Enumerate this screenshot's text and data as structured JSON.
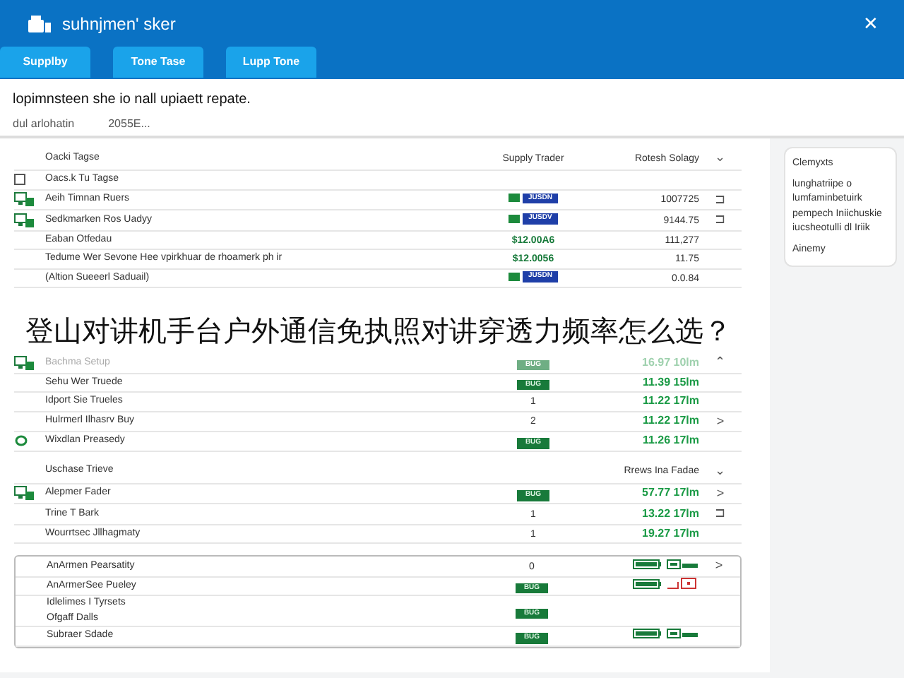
{
  "header": {
    "title": "suhnjmen' sker",
    "close": "✕"
  },
  "tabs": [
    {
      "label": "Supplby",
      "selected": false
    },
    {
      "label": "Tone Tase",
      "selected": false
    },
    {
      "label": "Lupp Tone",
      "selected": false
    }
  ],
  "info": {
    "line": "lopimnsteen she io nall upiaett repate.",
    "meta": [
      "dul arlohatin",
      "2055E..."
    ]
  },
  "sections": [
    {
      "title": "Oacki Tagse",
      "columns": [
        "Supply Trader",
        "Rotesh Solagy"
      ],
      "chevron": "⌄",
      "rows": [
        {
          "kind": "checkbox",
          "checked": false,
          "name": "Oacs.k Tu Tagse",
          "cells": []
        },
        {
          "kind": "monitor",
          "name": "Aeih Timnan Ruers",
          "cells": [
            {
              "kind": "badge",
              "text": "JUSDN"
            },
            {
              "kind": "text",
              "text": "1007725"
            }
          ],
          "action": "⊐"
        },
        {
          "kind": "monitor",
          "name": "Sedkmarken Ros Uadyy",
          "cells": [
            {
              "kind": "badge",
              "text": "JUSDV"
            },
            {
              "kind": "text",
              "text": "9144.75"
            }
          ],
          "action": "⊐"
        },
        {
          "kind": "plain",
          "name": "Eaban Otfedau",
          "cells": [
            {
              "kind": "money",
              "text": "$12.00A6"
            },
            {
              "kind": "text",
              "text": "111,277"
            }
          ]
        },
        {
          "kind": "plain",
          "name": "Tedume Wer Sevone Hee vpirkhuar de rhoamerk ph ir",
          "cells": [
            {
              "kind": "money",
              "text": "$12.0056"
            },
            {
              "kind": "text",
              "text": "11.75"
            }
          ]
        },
        {
          "kind": "plain",
          "name": "(Altion Sueeerl Saduail)",
          "cells": [
            {
              "kind": "badge",
              "text": "JUSDN"
            },
            {
              "kind": "text",
              "text": "0.0.84"
            }
          ]
        }
      ]
    },
    {
      "rows": [
        {
          "kind": "monitor",
          "disabled": true,
          "name": "Bachma Setup",
          "cells": [
            {
              "kind": "chip",
              "text": "BUG"
            },
            {
              "kind": "reading",
              "text": "16.97 10lm"
            }
          ],
          "action": "⌃"
        },
        {
          "kind": "plain",
          "disabled": false,
          "name": "Sehu Wer Truede",
          "cells": [
            {
              "kind": "chip",
              "text": "BUG"
            },
            {
              "kind": "reading",
              "text": "11.39 15lm"
            }
          ]
        },
        {
          "kind": "plain",
          "disabled": false,
          "name": "Idport Sie Trueles",
          "cells": [
            {
              "kind": "text",
              "text": "1"
            },
            {
              "kind": "reading",
              "text": "11.22 17lm"
            }
          ]
        },
        {
          "kind": "plain",
          "disabled": false,
          "name": "Hulrmerl Ilhasrv Buy",
          "cells": [
            {
              "kind": "text",
              "text": "2"
            },
            {
              "kind": "reading",
              "text": "11.22 17lm"
            }
          ],
          "action": ">"
        },
        {
          "kind": "ring",
          "disabled": false,
          "name": "Wixdlan Preasedy",
          "cells": [
            {
              "kind": "chip",
              "text": "BUG"
            },
            {
              "kind": "reading",
              "text": "11.26 17lm"
            }
          ]
        }
      ]
    },
    {
      "title": "Uschase Trieve",
      "columns": [
        "",
        "Rrews Ina Fadae"
      ],
      "chevron": "⌄",
      "rows": [
        {
          "kind": "monitor",
          "name": "Alepmer Fader",
          "cells": [
            {
              "kind": "chip",
              "text": "BUG"
            },
            {
              "kind": "reading",
              "text": "57.77 17lm"
            }
          ],
          "action": ">"
        },
        {
          "kind": "plain",
          "name": "Trine T Bark",
          "cells": [
            {
              "kind": "text",
              "text": "1"
            },
            {
              "kind": "reading",
              "text": "13.22 17lm"
            }
          ],
          "action": "⊐"
        },
        {
          "kind": "plain",
          "name": "Wourrtsec Jllhagmaty",
          "cells": [
            {
              "kind": "text",
              "text": "1"
            },
            {
              "kind": "reading",
              "text": "19.27 17lm"
            }
          ]
        }
      ]
    },
    {
      "rows": [
        {
          "name": "AnArmen Pearsatity",
          "cells": [
            {
              "kind": "text",
              "text": "0"
            }
          ],
          "indicators": [
            {
              "kind": "battery"
            },
            {
              "kind": "screen"
            }
          ],
          "action": ">"
        },
        {
          "name": "AnArmerSee Pueley",
          "cells": [
            {
              "kind": "chip",
              "text": "BUG"
            }
          ],
          "indicators": [
            {
              "kind": "battery"
            },
            {
              "kind": "alert"
            }
          ]
        },
        {
          "name": "Idlelimes I Tyrsets",
          "subname": "Ofgaff Dalls",
          "cells": [
            {
              "kind": "chip",
              "text": "BUG"
            }
          ]
        },
        {
          "name": "Subraer Sdade",
          "cells": [
            {
              "kind": "chip",
              "text": "BUG"
            }
          ],
          "indicators": [
            {
              "kind": "battery"
            },
            {
              "kind": "screen"
            }
          ]
        }
      ]
    }
  ],
  "side_card": {
    "title": "Clemyxts",
    "body": "lunghatriipe o lumfaminbetuirk pempech Iniichuskie iucsheotulli dl Iriik",
    "footer": "Ainemy"
  },
  "caption": "登山对讲机手台户外通信免执照对讲穿透力频率怎么选？"
}
